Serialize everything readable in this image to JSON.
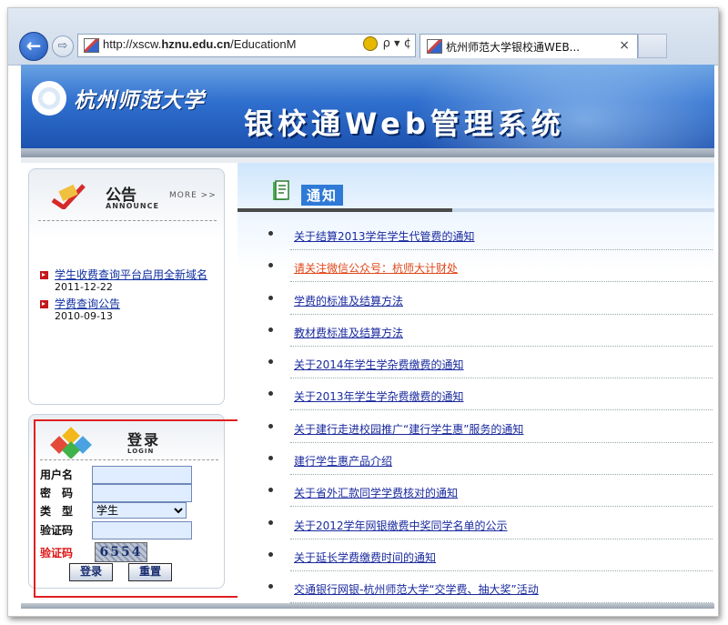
{
  "browser": {
    "url_host_prefix": "http://xscw.",
    "url_host_bold": "hznu.edu.cn",
    "url_path": "/EducationM",
    "search_symbol": "ρ ▾ ¢",
    "tab_title": "杭州师范大学银校通WEB...",
    "tab_close": "×",
    "back_symbol": "←",
    "forward_symbol": "⇨"
  },
  "header": {
    "school_name": "杭州师范大学",
    "system_title": "银校通Web管理系统"
  },
  "announce": {
    "title": "公告",
    "subtitle": "ANNOUNCE",
    "more": "MORE >>",
    "items": [
      {
        "title": "学生收费查询平台启用全新域名",
        "date": "2011-12-22"
      },
      {
        "title": "学费查询公告",
        "date": "2010-09-13"
      }
    ]
  },
  "login": {
    "title": "登录",
    "subtitle": "LOGIN",
    "username_label": "用户名",
    "password_label": "密　码",
    "type_label": "类　型",
    "type_selected": "学生",
    "captcha_input_label": "验证码",
    "captcha_label": "验证码",
    "captcha_text": "6554",
    "login_button": "登录",
    "reset_button": "重置"
  },
  "notices": {
    "title": "通知",
    "items": [
      {
        "text": "关于结算2013学年学生代管费的通知",
        "alert": false
      },
      {
        "text": "请关注微信公众号：杭师大计财处",
        "alert": true
      },
      {
        "text": "学费的标准及结算方法",
        "alert": false
      },
      {
        "text": "教材费标准及结算方法",
        "alert": false
      },
      {
        "text": "关于2014年学生学杂费缴费的通知",
        "alert": false
      },
      {
        "text": "关于2013年学生学杂费缴费的通知",
        "alert": false
      },
      {
        "text": "关于建行走进校园推广“建行学生惠”服务的通知",
        "alert": false
      },
      {
        "text": "建行学生惠产品介绍",
        "alert": false
      },
      {
        "text": "关于省外汇款同学学费核对的通知",
        "alert": false
      },
      {
        "text": "关于2012学年网银缴费中奖同学名单的公示",
        "alert": false
      },
      {
        "text": "关于延长学费缴费时间的通知",
        "alert": false
      },
      {
        "text": "交通银行网银-杭州师范大学“交学费、抽大奖”活动",
        "alert": false
      }
    ]
  },
  "colors": {
    "banner": "#2f6fce",
    "link": "#1a2a9e",
    "alert_link": "#e0481a",
    "highlight_border": "#e02020"
  }
}
